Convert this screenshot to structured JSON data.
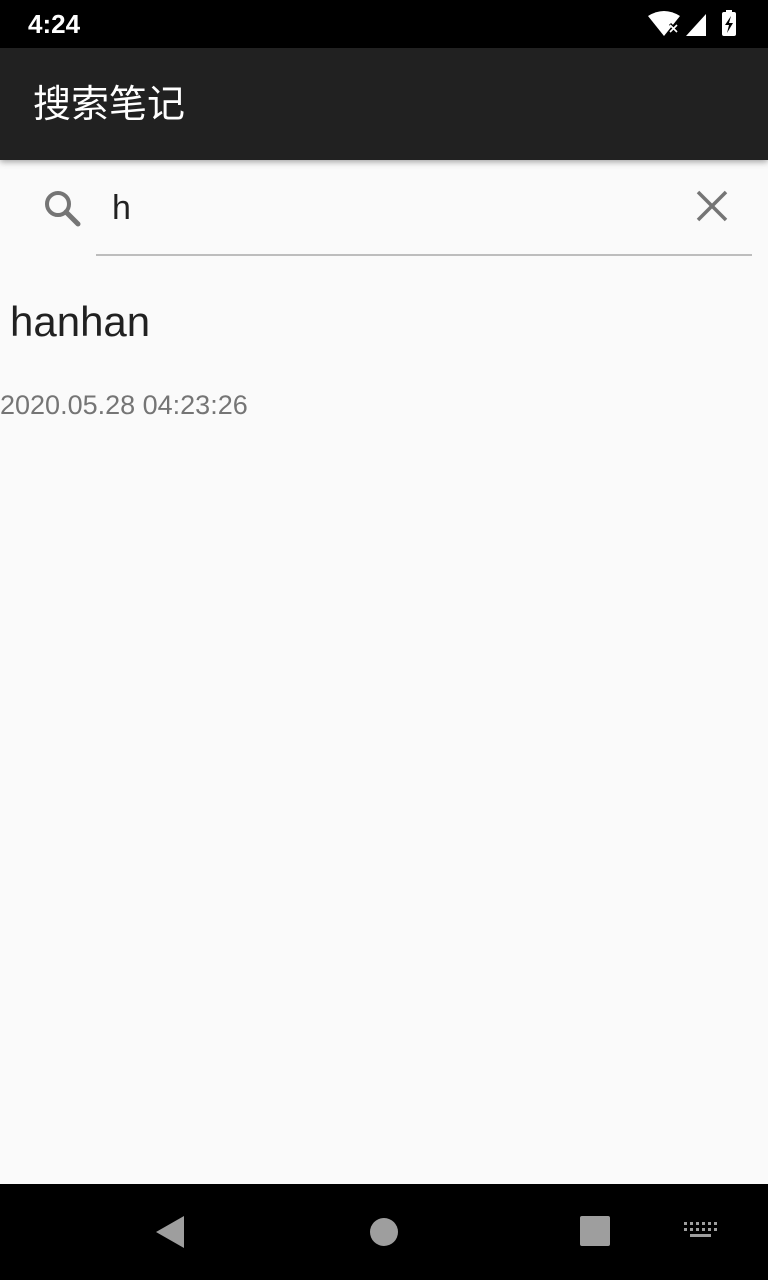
{
  "status_bar": {
    "time": "4:24",
    "icons": [
      "wifi-icon",
      "cellular-signal-icon",
      "battery-charging-icon"
    ]
  },
  "app_bar": {
    "title": "搜索笔记"
  },
  "search": {
    "value": "h",
    "icons": [
      "search-icon",
      "clear-icon"
    ]
  },
  "results": [
    {
      "title": "hanhan",
      "timestamp": "2020.05.28 04:23:26"
    }
  ],
  "nav_bar": {
    "icons": [
      "back-icon",
      "home-icon",
      "recents-icon",
      "keyboard-icon"
    ]
  }
}
